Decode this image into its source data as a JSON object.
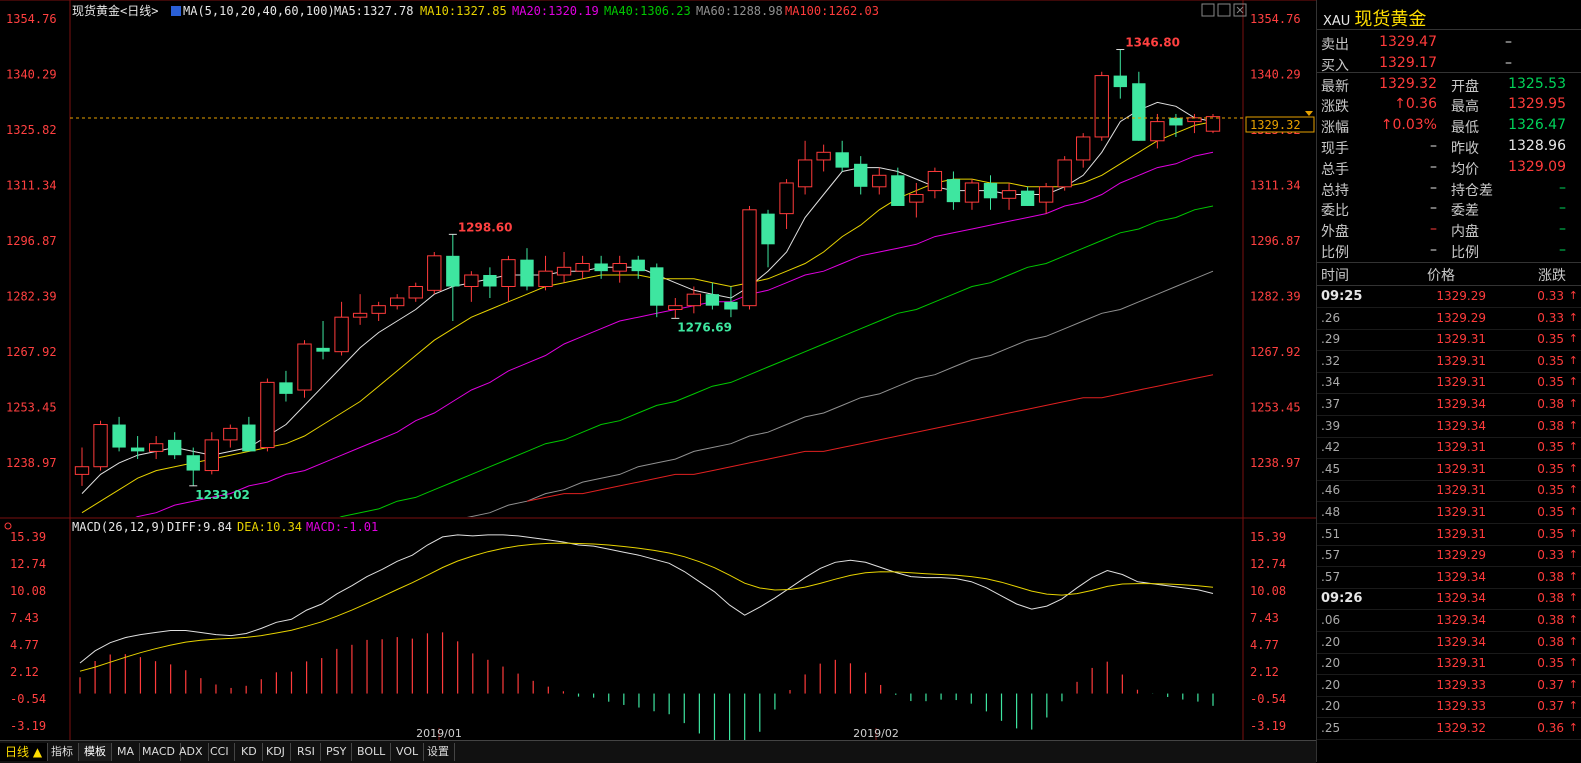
{
  "header": {
    "title": "现货黄金<日线>",
    "ma_label": "MA(5,10,20,40,60,100)",
    "ma5": "MA5:1327.78",
    "ma10": "MA10:1327.85",
    "ma20": "MA20:1320.19",
    "ma40": "MA40:1306.23",
    "ma60": "MA60:1288.98",
    "ma100": "MA100:1262.03"
  },
  "macd_header": {
    "label": "MACD(26,12,9)",
    "diff": "DIFF:9.84",
    "dea": "DEA:10.34",
    "macd": "MACD:-1.01"
  },
  "colors": {
    "up": "#ff3b3b",
    "down": "#3ee6a0",
    "ma5": "#e0e0e0",
    "ma10": "#e6d200",
    "ma20": "#e000e0",
    "ma40": "#00c800",
    "ma60": "#909090",
    "ma100": "#e02020"
  },
  "chart_data": [
    {
      "type": "candlestick",
      "price_ticks": [
        "1354.76",
        "1340.29",
        "1325.82",
        "1311.34",
        "1296.87",
        "1282.39",
        "1267.92",
        "1253.45",
        "1238.97"
      ],
      "ylim": [
        1228.5,
        1354.76
      ],
      "x_labels": [
        "2019/01",
        "2019/02"
      ],
      "annotations": [
        "1346.80",
        "1298.60",
        "1276.69",
        "1233.02"
      ],
      "current_price": "1329.32",
      "candles": [
        {
          "o": 1236,
          "h": 1243,
          "l": 1233,
          "c": 1238
        },
        {
          "o": 1238,
          "h": 1250,
          "l": 1237,
          "c": 1249
        },
        {
          "o": 1249,
          "h": 1251,
          "l": 1242,
          "c": 1243
        },
        {
          "o": 1243,
          "h": 1246,
          "l": 1240,
          "c": 1242
        },
        {
          "o": 1242,
          "h": 1246,
          "l": 1240,
          "c": 1244
        },
        {
          "o": 1245,
          "h": 1247,
          "l": 1240,
          "c": 1241
        },
        {
          "o": 1241,
          "h": 1243,
          "l": 1233.02,
          "c": 1237
        },
        {
          "o": 1237,
          "h": 1247,
          "l": 1236,
          "c": 1245
        },
        {
          "o": 1245,
          "h": 1249,
          "l": 1243,
          "c": 1248
        },
        {
          "o": 1249,
          "h": 1251,
          "l": 1243,
          "c": 1242
        },
        {
          "o": 1243,
          "h": 1261,
          "l": 1242,
          "c": 1260
        },
        {
          "o": 1260,
          "h": 1263,
          "l": 1255,
          "c": 1257
        },
        {
          "o": 1258,
          "h": 1271,
          "l": 1256,
          "c": 1270
        },
        {
          "o": 1269,
          "h": 1276,
          "l": 1266,
          "c": 1268
        },
        {
          "o": 1268,
          "h": 1281,
          "l": 1267,
          "c": 1277
        },
        {
          "o": 1277,
          "h": 1283,
          "l": 1275,
          "c": 1278
        },
        {
          "o": 1278,
          "h": 1281,
          "l": 1276,
          "c": 1280
        },
        {
          "o": 1280,
          "h": 1283,
          "l": 1279,
          "c": 1282
        },
        {
          "o": 1282,
          "h": 1286,
          "l": 1281,
          "c": 1285
        },
        {
          "o": 1284,
          "h": 1294,
          "l": 1283,
          "c": 1293
        },
        {
          "o": 1293,
          "h": 1298.6,
          "l": 1276,
          "c": 1285
        },
        {
          "o": 1285,
          "h": 1289,
          "l": 1281,
          "c": 1288
        },
        {
          "o": 1288,
          "h": 1290,
          "l": 1282,
          "c": 1285
        },
        {
          "o": 1285,
          "h": 1293,
          "l": 1281,
          "c": 1292
        },
        {
          "o": 1292,
          "h": 1295,
          "l": 1284,
          "c": 1285
        },
        {
          "o": 1285,
          "h": 1293,
          "l": 1284,
          "c": 1289
        },
        {
          "o": 1288,
          "h": 1294,
          "l": 1286,
          "c": 1290
        },
        {
          "o": 1289,
          "h": 1293,
          "l": 1287,
          "c": 1291
        },
        {
          "o": 1291,
          "h": 1293,
          "l": 1287,
          "c": 1289
        },
        {
          "o": 1289,
          "h": 1293,
          "l": 1286,
          "c": 1291
        },
        {
          "o": 1292,
          "h": 1293,
          "l": 1287,
          "c": 1289
        },
        {
          "o": 1290,
          "h": 1291,
          "l": 1277,
          "c": 1280
        },
        {
          "o": 1279,
          "h": 1282,
          "l": 1276.69,
          "c": 1280
        },
        {
          "o": 1280,
          "h": 1285,
          "l": 1278,
          "c": 1283
        },
        {
          "o": 1283,
          "h": 1286,
          "l": 1279,
          "c": 1280
        },
        {
          "o": 1281,
          "h": 1285,
          "l": 1277,
          "c": 1279
        },
        {
          "o": 1280,
          "h": 1306,
          "l": 1279,
          "c": 1305
        },
        {
          "o": 1304,
          "h": 1305,
          "l": 1290,
          "c": 1296
        },
        {
          "o": 1304,
          "h": 1313,
          "l": 1300,
          "c": 1312
        },
        {
          "o": 1311,
          "h": 1323,
          "l": 1309,
          "c": 1318
        },
        {
          "o": 1318,
          "h": 1322,
          "l": 1315,
          "c": 1320
        },
        {
          "o": 1320,
          "h": 1323,
          "l": 1315,
          "c": 1316
        },
        {
          "o": 1317,
          "h": 1319,
          "l": 1309,
          "c": 1311
        },
        {
          "o": 1311,
          "h": 1316,
          "l": 1309,
          "c": 1314
        },
        {
          "o": 1314,
          "h": 1316,
          "l": 1306,
          "c": 1306
        },
        {
          "o": 1307,
          "h": 1312,
          "l": 1303,
          "c": 1309
        },
        {
          "o": 1310,
          "h": 1316,
          "l": 1308,
          "c": 1315
        },
        {
          "o": 1313,
          "h": 1315,
          "l": 1305,
          "c": 1307
        },
        {
          "o": 1307,
          "h": 1313,
          "l": 1305,
          "c": 1312
        },
        {
          "o": 1312,
          "h": 1314,
          "l": 1305,
          "c": 1308
        },
        {
          "o": 1308,
          "h": 1312,
          "l": 1305,
          "c": 1310
        },
        {
          "o": 1310,
          "h": 1311,
          "l": 1306,
          "c": 1306
        },
        {
          "o": 1307,
          "h": 1312,
          "l": 1304,
          "c": 1311
        },
        {
          "o": 1311,
          "h": 1319,
          "l": 1310,
          "c": 1318
        },
        {
          "o": 1318,
          "h": 1325,
          "l": 1316,
          "c": 1324
        },
        {
          "o": 1324,
          "h": 1341,
          "l": 1323,
          "c": 1340
        },
        {
          "o": 1340,
          "h": 1346.8,
          "l": 1334,
          "c": 1337
        },
        {
          "o": 1338,
          "h": 1341,
          "l": 1323,
          "c": 1323
        },
        {
          "o": 1323,
          "h": 1330,
          "l": 1321,
          "c": 1328
        },
        {
          "o": 1329,
          "h": 1330,
          "l": 1324,
          "c": 1327
        },
        {
          "o": 1328,
          "h": 1330,
          "l": 1325,
          "c": 1329
        },
        {
          "o": 1325.5,
          "h": 1330,
          "l": 1325,
          "c": 1329.3
        }
      ],
      "ma_lines": [
        {
          "name": "MA5",
          "values": [
            1231,
            1236,
            1239,
            1241,
            1242,
            1243,
            1242,
            1241,
            1242,
            1243,
            1246,
            1249,
            1254,
            1259,
            1264,
            1269,
            1273,
            1276,
            1279,
            1283,
            1285,
            1286,
            1287,
            1288,
            1288,
            1288,
            1289,
            1289,
            1290,
            1290,
            1290,
            1288,
            1286,
            1284,
            1283,
            1282,
            1285,
            1289,
            1294,
            1303,
            1309,
            1315,
            1316,
            1316,
            1315,
            1313,
            1311,
            1310,
            1310,
            1310,
            1309,
            1309,
            1309,
            1311,
            1314,
            1320,
            1328,
            1331,
            1333,
            1332,
            1329,
            1328
          ]
        },
        {
          "name": "MA10",
          "values": [
            1226,
            1229,
            1232,
            1235,
            1237,
            1238,
            1239,
            1240,
            1241,
            1242,
            1243,
            1244,
            1246,
            1249,
            1252,
            1255,
            1259,
            1263,
            1267,
            1271,
            1274,
            1277,
            1279,
            1281,
            1283,
            1285,
            1286,
            1287,
            1288,
            1288,
            1288,
            1287,
            1287,
            1287,
            1286,
            1285,
            1286,
            1287,
            1289,
            1291,
            1294,
            1298,
            1301,
            1305,
            1308,
            1310,
            1312,
            1313,
            1313,
            1312,
            1312,
            1311,
            1311,
            1311,
            1312,
            1314,
            1317,
            1320,
            1323,
            1325,
            1327,
            1328
          ]
        },
        {
          "name": "MA20",
          "values": [
            1220,
            1222,
            1223,
            1225,
            1226,
            1228,
            1229,
            1230,
            1231,
            1233,
            1234,
            1236,
            1237,
            1239,
            1241,
            1243,
            1245,
            1247,
            1250,
            1252,
            1255,
            1258,
            1260,
            1263,
            1265,
            1267,
            1270,
            1272,
            1274,
            1276,
            1277,
            1278,
            1279,
            1280,
            1281,
            1281,
            1283,
            1284,
            1286,
            1288,
            1289,
            1291,
            1293,
            1294,
            1295,
            1296,
            1298,
            1299,
            1300,
            1301,
            1302,
            1303,
            1304,
            1306,
            1307,
            1309,
            1312,
            1314,
            1316,
            1317,
            1319,
            1320
          ]
        },
        {
          "name": "MA40",
          "values": [
            1214,
            1215,
            1215,
            1216,
            1216,
            1217,
            1218,
            1218,
            1219,
            1219,
            1220,
            1221,
            1222,
            1223,
            1225,
            1226,
            1227,
            1229,
            1230,
            1232,
            1234,
            1236,
            1238,
            1240,
            1242,
            1244,
            1245,
            1247,
            1249,
            1250,
            1252,
            1254,
            1255,
            1257,
            1259,
            1260,
            1262,
            1264,
            1266,
            1268,
            1270,
            1272,
            1274,
            1276,
            1278,
            1279,
            1281,
            1283,
            1285,
            1286,
            1288,
            1290,
            1291,
            1293,
            1295,
            1297,
            1299,
            1300,
            1302,
            1303,
            1305,
            1306
          ]
        },
        {
          "name": "MA60",
          "values": [
            1208,
            1208,
            1209,
            1209,
            1210,
            1210,
            1211,
            1211,
            1212,
            1213,
            1213,
            1214,
            1215,
            1216,
            1217,
            1218,
            1219,
            1220,
            1221,
            1222,
            1224,
            1225,
            1226,
            1228,
            1229,
            1231,
            1232,
            1234,
            1235,
            1236,
            1238,
            1239,
            1240,
            1242,
            1243,
            1244,
            1246,
            1247,
            1249,
            1251,
            1252,
            1254,
            1256,
            1257,
            1259,
            1261,
            1262,
            1264,
            1266,
            1267,
            1269,
            1271,
            1272,
            1274,
            1276,
            1278,
            1279,
            1281,
            1283,
            1285,
            1287,
            1289
          ]
        },
        {
          "name": "MA100",
          "values": [
            null,
            null,
            null,
            null,
            null,
            null,
            null,
            null,
            null,
            null,
            null,
            null,
            null,
            null,
            null,
            null,
            null,
            null,
            null,
            null,
            null,
            null,
            null,
            null,
            1229,
            1230,
            1231,
            1231,
            1232,
            1233,
            1234,
            1235,
            1236,
            1236,
            1237,
            1238,
            1239,
            1240,
            1241,
            1242,
            1242,
            1243,
            1244,
            1245,
            1246,
            1247,
            1248,
            1249,
            1250,
            1251,
            1252,
            1253,
            1254,
            1255,
            1256,
            1256,
            1257,
            1258,
            1259,
            1260,
            1261,
            1262
          ]
        }
      ]
    },
    {
      "type": "macd",
      "y_ticks": [
        "15.39",
        "12.74",
        "10.08",
        "7.43",
        "4.77",
        "2.12",
        "-0.54",
        "-3.19"
      ],
      "ylim": [
        -5.5,
        16.5
      ],
      "diff": [
        3.0,
        4.2,
        5.0,
        5.5,
        5.8,
        6.0,
        6.2,
        6.2,
        6.0,
        5.8,
        5.7,
        5.9,
        6.4,
        7.0,
        7.3,
        8.2,
        8.8,
        9.8,
        10.6,
        11.5,
        12.2,
        13.0,
        13.6,
        14.6,
        15.4,
        15.6,
        15.5,
        15.6,
        15.6,
        15.5,
        15.3,
        15.1,
        14.9,
        14.6,
        14.5,
        14.2,
        13.9,
        13.6,
        13.2,
        12.8,
        12.0,
        11.0,
        10.0,
        8.7,
        7.7,
        8.5,
        9.4,
        10.4,
        11.4,
        12.3,
        12.9,
        13.1,
        12.9,
        12.4,
        11.9,
        11.5,
        11.4,
        11.4,
        11.3,
        11.0,
        10.4,
        9.6,
        8.8,
        8.3,
        8.6,
        9.3,
        10.4,
        11.4,
        12.1,
        11.7,
        11.0,
        10.8,
        10.6,
        10.4,
        10.2,
        9.84
      ]
    }
  ],
  "panel": {
    "symbol": "XAU",
    "name": "现货黄金",
    "quotes": [
      {
        "l1": "卖出",
        "v1": "1329.47",
        "l2": "",
        "v2": "–"
      },
      {
        "l1": "买入",
        "v1": "1329.17",
        "l2": "",
        "v2": "–"
      },
      {
        "l1": "最新",
        "v1": "1329.32",
        "l2": "开盘",
        "v2": "1325.53"
      },
      {
        "l1": "涨跌",
        "v1": "↑0.36",
        "l2": "最高",
        "v2": "1329.95"
      },
      {
        "l1": "涨幅",
        "v1": "↑0.03%",
        "l2": "最低",
        "v2": "1326.47"
      },
      {
        "l1": "现手",
        "v1": "–",
        "l2": "昨收",
        "v2": "1328.96"
      },
      {
        "l1": "总手",
        "v1": "–",
        "l2": "均价",
        "v2": "1329.09"
      },
      {
        "l1": "总持",
        "v1": "–",
        "l2": "持仓差",
        "v2": "–"
      },
      {
        "l1": "委比",
        "v1": "–",
        "l2": "委差",
        "v2": "–"
      },
      {
        "l1": "外盘",
        "v1": "–",
        "l2": "内盘",
        "v2": "–"
      },
      {
        "l1": "比例",
        "v1": "–",
        "l2": "比例",
        "v2": "–"
      }
    ],
    "tick_header": {
      "time": "时间",
      "price": "价格",
      "change": "涨跌"
    },
    "ticks": [
      {
        "time": "09:25",
        "price": "1329.29",
        "change": "0.33"
      },
      {
        "time": ".26",
        "price": "1329.29",
        "change": "0.33"
      },
      {
        "time": ".29",
        "price": "1329.31",
        "change": "0.35"
      },
      {
        "time": ".32",
        "price": "1329.31",
        "change": "0.35"
      },
      {
        "time": ".34",
        "price": "1329.31",
        "change": "0.35"
      },
      {
        "time": ".37",
        "price": "1329.34",
        "change": "0.38"
      },
      {
        "time": ".39",
        "price": "1329.34",
        "change": "0.38"
      },
      {
        "time": ".42",
        "price": "1329.31",
        "change": "0.35"
      },
      {
        "time": ".45",
        "price": "1329.31",
        "change": "0.35"
      },
      {
        "time": ".46",
        "price": "1329.31",
        "change": "0.35"
      },
      {
        "time": ".48",
        "price": "1329.31",
        "change": "0.35"
      },
      {
        "time": ".51",
        "price": "1329.31",
        "change": "0.35"
      },
      {
        "time": ".57",
        "price": "1329.29",
        "change": "0.33"
      },
      {
        "time": ".57",
        "price": "1329.34",
        "change": "0.38"
      },
      {
        "time": "09:26",
        "price": "1329.34",
        "change": "0.38"
      },
      {
        "time": ".06",
        "price": "1329.34",
        "change": "0.38"
      },
      {
        "time": ".20",
        "price": "1329.34",
        "change": "0.38"
      },
      {
        "time": ".20",
        "price": "1329.31",
        "change": "0.35"
      },
      {
        "time": ".20",
        "price": "1329.33",
        "change": "0.37"
      },
      {
        "time": ".20",
        "price": "1329.33",
        "change": "0.37"
      },
      {
        "time": ".25",
        "price": "1329.32",
        "change": "0.36"
      }
    ]
  },
  "bottom_tabs": [
    "日线 ▲",
    "指标",
    "模板",
    "MA",
    "MACD",
    "ADX",
    "CCI",
    "KD",
    "KDJ",
    "RSI",
    "PSY",
    "BOLL",
    "VOL",
    "设置"
  ]
}
